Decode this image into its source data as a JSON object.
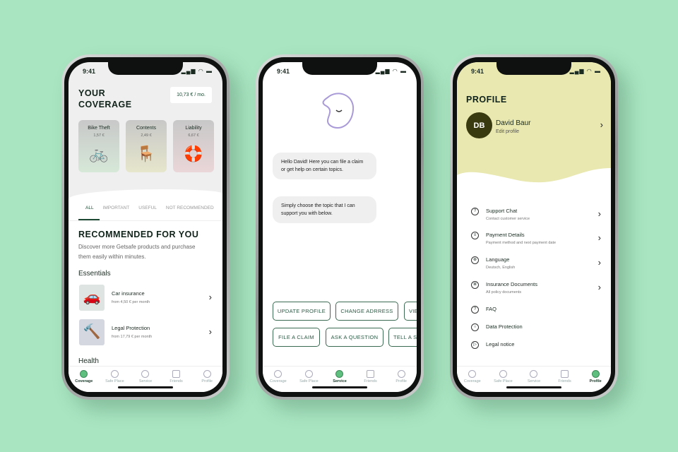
{
  "status_time": "9:41",
  "colors": {
    "background": "#a9e5c1",
    "accent": "#3c8a58",
    "profile_header": "#e8e8b0",
    "avatar": "#3a3a10"
  },
  "tabbar": [
    {
      "label": "Coverage",
      "icon": "shield-icon"
    },
    {
      "label": "Safe Place",
      "icon": "target-icon"
    },
    {
      "label": "Service",
      "icon": "chat-face-icon"
    },
    {
      "label": "Friends",
      "icon": "gift-icon"
    },
    {
      "label": "Profile",
      "icon": "person-icon"
    }
  ],
  "coverage": {
    "title1": "YOUR",
    "title2": "COVERAGE",
    "price": "10,73 € / mo.",
    "cards": [
      {
        "name": "Bike Theft",
        "price": "1,57 €",
        "icon": "bicycle-icon"
      },
      {
        "name": "Contents",
        "price": "2,49 €",
        "icon": "furniture-icon"
      },
      {
        "name": "Liability",
        "price": "6,67 €",
        "icon": "lifebuoy-icon"
      }
    ],
    "tabs": [
      "ALL",
      "IMPORTANT",
      "USEFUL",
      "NOT RECOMMENDED"
    ],
    "rec_title": "RECOMMENDED FOR YOU",
    "rec_desc": "Discover more Getsafe products and purchase them easily within minutes.",
    "essentials": "Essentials",
    "items": [
      {
        "title": "Car insurance",
        "sub": "from 4,50 € per month",
        "icon": "car-icon"
      },
      {
        "title": "Legal Protection",
        "sub": "from 17,79 € per month",
        "icon": "gavel-icon"
      }
    ],
    "health": "Health"
  },
  "service": {
    "bubbles": [
      "Hello David! Here you can file a claim or get help on certain topics.",
      "Simply choose the topic that I can support you with below."
    ],
    "row1": [
      "UPDATE PROFILE",
      "CHANGE ADRRESS",
      "VIEW"
    ],
    "row2": [
      "FILE A CLAIM",
      "ASK A QUESTION",
      "TELL A STORY"
    ]
  },
  "profile": {
    "title": "PROFILE",
    "initials": "DB",
    "name": "David Baur",
    "edit": "Edit profile",
    "items": [
      {
        "title": "Support Chat",
        "sub": "Contact customer service",
        "icon": "chat-question-icon",
        "chevron": true
      },
      {
        "title": "Payment Details",
        "sub": "Payment method and next payment date",
        "icon": "receipt-icon",
        "chevron": true
      },
      {
        "title": "Language",
        "sub": "Deutsch, English",
        "icon": "globe-icon",
        "chevron": true
      },
      {
        "title": "Insurance Documents",
        "sub": "All policy documents",
        "icon": "documents-icon",
        "chevron": true
      },
      {
        "title": "FAQ",
        "sub": "",
        "icon": "question-icon",
        "chevron": false
      },
      {
        "title": "Data Protection",
        "sub": "",
        "icon": "shield-circle-icon",
        "chevron": false
      },
      {
        "title": "Legal notice",
        "sub": "",
        "icon": "legal-icon",
        "chevron": false
      }
    ]
  }
}
